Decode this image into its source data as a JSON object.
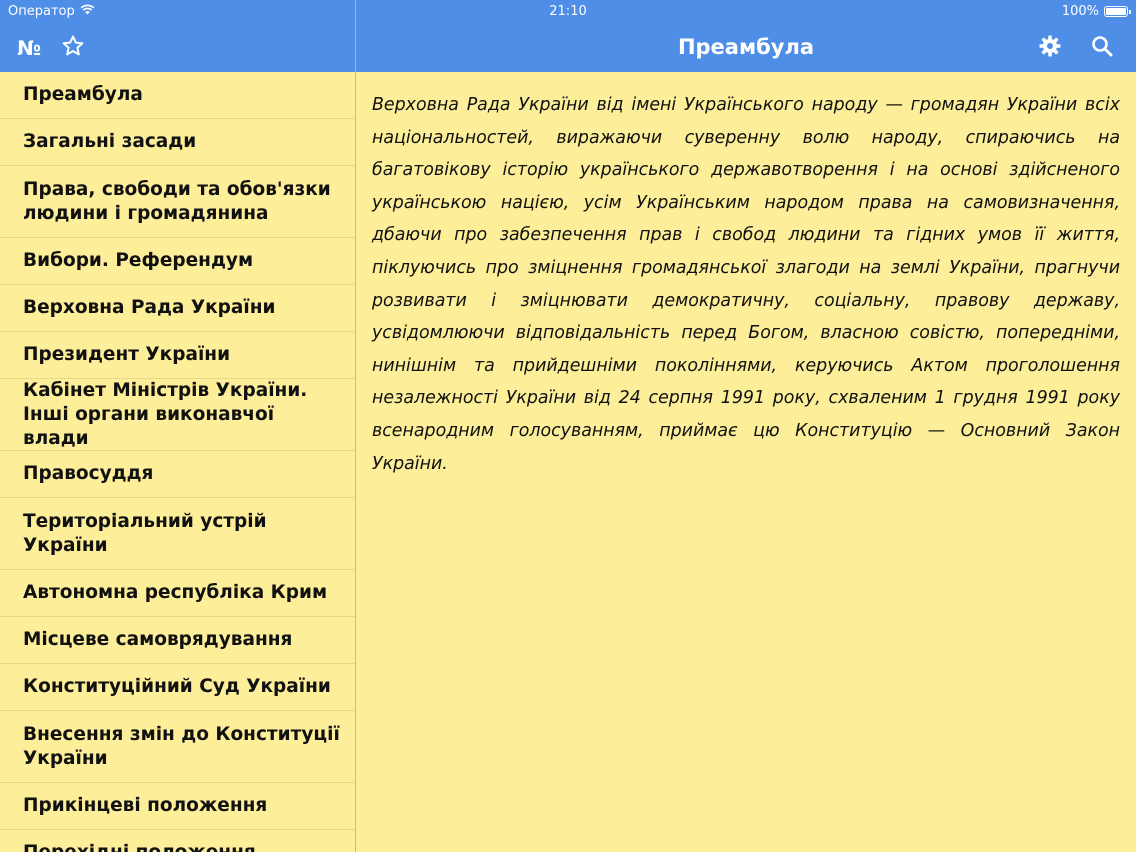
{
  "status": {
    "carrier": "Оператор",
    "time": "21:10",
    "battery_percent": "100%",
    "battery_level": 1.0
  },
  "sidebar_nav": {
    "numbering_label": "№",
    "favorites_icon": "star-outline-icon"
  },
  "main_nav": {
    "title": "Преамбула",
    "settings_icon": "gear-icon",
    "search_icon": "search-icon"
  },
  "sidebar": {
    "items": [
      {
        "label": "Преамбула",
        "lines": 1
      },
      {
        "label": "Загальні засади",
        "lines": 1
      },
      {
        "label": "Права, свободи та обов'язки людини і громадянина",
        "lines": 2
      },
      {
        "label": "Вибори. Референдум",
        "lines": 1
      },
      {
        "label": "Верховна Рада України",
        "lines": 1
      },
      {
        "label": "Президент України",
        "lines": 1
      },
      {
        "label": "Кабінет Міністрів України. Інші органи виконавчої влади",
        "lines": 2
      },
      {
        "label": "Правосуддя",
        "lines": 1
      },
      {
        "label": "Територіальний устрій України",
        "lines": 2
      },
      {
        "label": "Автономна республіка Крим",
        "lines": 1
      },
      {
        "label": "Місцеве самоврядування",
        "lines": 1
      },
      {
        "label": "Конституційний Суд України",
        "lines": 1
      },
      {
        "label": "Внесення змін до Конституції України",
        "lines": 2
      },
      {
        "label": "Прикінцеві положення",
        "lines": 1
      },
      {
        "label": "Перехідні положення",
        "lines": 1
      }
    ]
  },
  "content": {
    "text": "Верховна Рада України від імені Українського народу — громадян України всіх національностей, виражаючи суверенну волю народу, спираючись на багатовікову історію українського державотворення і на основі здійсненого українською нацією, усім Українським народом права на самовизначення, дбаючи про забезпечення прав і свобод людини та гідних умов її життя, піклуючись про зміцнення громадянської злагоди на землі України, прагнучи розвивати і зміцнювати демократичну, соціальну, правову державу, усвідомлюючи відповідальність перед Богом, власною совістю, попередніми, нинішнім та прийдешніми поколіннями, керуючись Актом проголошення незалежності України від 24 серпня 1991 року, схваленим 1 грудня 1991 року всенародним голосуванням, приймає цю Конституцію — Основний Закон України."
  },
  "colors": {
    "header_blue": "#4e8ee7",
    "background_yellow": "#fdee99",
    "text": "#111111"
  }
}
